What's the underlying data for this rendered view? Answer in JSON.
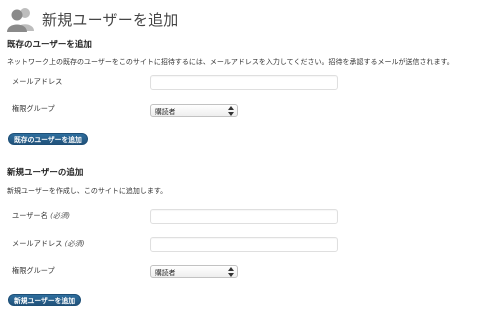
{
  "header": {
    "title": "新規ユーザーを追加",
    "icon": "users-icon"
  },
  "existing_user": {
    "heading": "既存のユーザーを追加",
    "description": "ネットワーク上の既存のユーザーをこのサイトに招待するには、メールアドレスを入力してください。招待を承認するメールが送信されます。",
    "email_label": "メールアドレス",
    "email_value": "",
    "role_label": "権限グループ",
    "role_selected": "購読者",
    "submit_label": "既存のユーザーを追加"
  },
  "new_user": {
    "heading": "新規ユーザーの追加",
    "description": "新規ユーザーを作成し、このサイトに追加します。",
    "username_label": "ユーザー名",
    "username_required": "(必須)",
    "username_value": "",
    "email_label": "メールアドレス",
    "email_required": "(必須)",
    "email_value": "",
    "role_label": "権限グループ",
    "role_selected": "購読者",
    "submit_label": "新規ユーザーを追加"
  },
  "colors": {
    "button_blue": "#21527a",
    "title_gray": "#464646"
  }
}
